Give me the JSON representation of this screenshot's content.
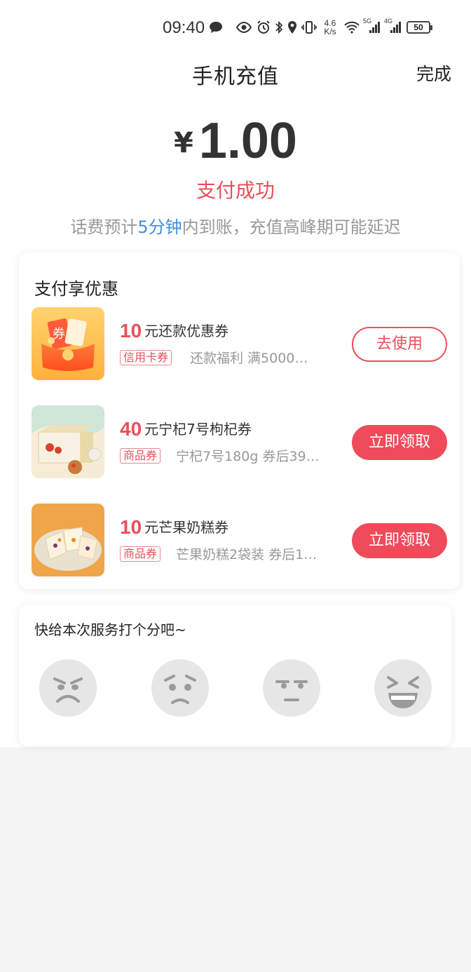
{
  "status_bar": {
    "time": "09:40",
    "net_speed_value": "4.6",
    "net_speed_unit": "K/s",
    "signal1": "5G",
    "signal2": "4G",
    "battery": "50"
  },
  "header": {
    "title": "手机充值",
    "done_label": "完成"
  },
  "payment": {
    "currency": "¥",
    "amount": "1.00",
    "status": "支付成功",
    "note_before": "话费预计",
    "note_highlight": "5分钟",
    "note_after": "内到账，充值高峰期可能延迟"
  },
  "coupons": {
    "section_title": "支付享优惠",
    "items": [
      {
        "amount": "10",
        "title": "元还款优惠券",
        "tag": "信用卡券",
        "desc": "还款福利 满5000…",
        "action": "去使用",
        "style": "outline"
      },
      {
        "amount": "40",
        "title": "元宁杞7号枸杞券",
        "tag": "商品券",
        "desc": "宁杞7号180g 券后39…",
        "action": "立即领取",
        "style": "solid"
      },
      {
        "amount": "10",
        "title": "元芒果奶糕券",
        "tag": "商品券",
        "desc": "芒果奶糕2袋装 券后1…",
        "action": "立即领取",
        "style": "solid"
      }
    ]
  },
  "rating": {
    "title": "快给本次服务打个分吧~",
    "faces": [
      "angry-face-icon",
      "sad-face-icon",
      "neutral-face-icon",
      "laughing-face-icon"
    ]
  },
  "colors": {
    "accent_red": "#e8505b",
    "highlight_blue": "#3e8ee6",
    "button_red": "#f04b5b"
  }
}
